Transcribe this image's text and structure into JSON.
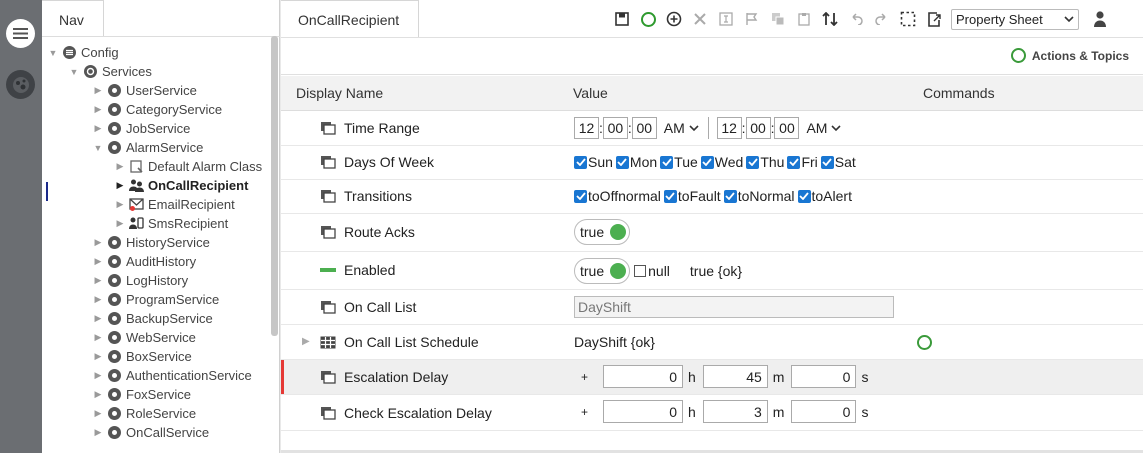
{
  "nav": {
    "tab": "Nav",
    "tree": [
      {
        "label": "Config",
        "depth": 0,
        "icon": "config-icon",
        "expand": "open"
      },
      {
        "label": "Services",
        "depth": 1,
        "icon": "services-icon",
        "expand": "open"
      },
      {
        "label": "UserService",
        "depth": 2,
        "icon": "user-service-icon",
        "expand": "closed"
      },
      {
        "label": "CategoryService",
        "depth": 2,
        "icon": "category-service-icon",
        "expand": "closed"
      },
      {
        "label": "JobService",
        "depth": 2,
        "icon": "job-service-icon",
        "expand": "closed"
      },
      {
        "label": "AlarmService",
        "depth": 2,
        "icon": "alarm-service-icon",
        "expand": "open"
      },
      {
        "label": "Default Alarm Class",
        "depth": 3,
        "icon": "alarm-class-icon",
        "expand": "closed"
      },
      {
        "label": "OnCallRecipient",
        "depth": 3,
        "icon": "on-call-recipient-icon",
        "expand": "closed",
        "selected": true
      },
      {
        "label": "EmailRecipient",
        "depth": 3,
        "icon": "email-recipient-icon",
        "expand": "closed"
      },
      {
        "label": "SmsRecipient",
        "depth": 3,
        "icon": "sms-recipient-icon",
        "expand": "closed"
      },
      {
        "label": "HistoryService",
        "depth": 2,
        "icon": "history-service-icon",
        "expand": "closed"
      },
      {
        "label": "AuditHistory",
        "depth": 2,
        "icon": "audit-history-icon",
        "expand": "closed"
      },
      {
        "label": "LogHistory",
        "depth": 2,
        "icon": "log-history-icon",
        "expand": "closed"
      },
      {
        "label": "ProgramService",
        "depth": 2,
        "icon": "program-service-icon",
        "expand": "closed"
      },
      {
        "label": "BackupService",
        "depth": 2,
        "icon": "backup-service-icon",
        "expand": "closed"
      },
      {
        "label": "WebService",
        "depth": 2,
        "icon": "web-service-icon",
        "expand": "closed"
      },
      {
        "label": "BoxService",
        "depth": 2,
        "icon": "box-service-icon",
        "expand": "closed"
      },
      {
        "label": "AuthenticationService",
        "depth": 2,
        "icon": "authentication-service-icon",
        "expand": "closed"
      },
      {
        "label": "FoxService",
        "depth": 2,
        "icon": "fox-service-icon",
        "expand": "closed"
      },
      {
        "label": "RoleService",
        "depth": 2,
        "icon": "role-service-icon",
        "expand": "closed"
      },
      {
        "label": "OnCallService",
        "depth": 2,
        "icon": "on-call-service-icon",
        "expand": "closed"
      }
    ]
  },
  "main": {
    "tab": "OnCallRecipient",
    "view_select": "Property Sheet",
    "actions_label": "Actions & Topics",
    "columns": {
      "name": "Display Name",
      "value": "Value",
      "commands": "Commands"
    },
    "time_range": {
      "label": "Time Range",
      "start": {
        "h": "12",
        "m": "00",
        "s": "00",
        "ampm": "AM"
      },
      "end": {
        "h": "12",
        "m": "00",
        "s": "00",
        "ampm": "AM"
      }
    },
    "days_of_week": {
      "label": "Days Of Week",
      "items": [
        {
          "label": "Sun",
          "checked": true
        },
        {
          "label": "Mon",
          "checked": true
        },
        {
          "label": "Tue",
          "checked": true
        },
        {
          "label": "Wed",
          "checked": true
        },
        {
          "label": "Thu",
          "checked": true
        },
        {
          "label": "Fri",
          "checked": true
        },
        {
          "label": "Sat",
          "checked": true
        }
      ]
    },
    "transitions": {
      "label": "Transitions",
      "items": [
        {
          "label": "toOffnormal",
          "checked": true
        },
        {
          "label": "toFault",
          "checked": true
        },
        {
          "label": "toNormal",
          "checked": true
        },
        {
          "label": "toAlert",
          "checked": true
        }
      ]
    },
    "route_acks": {
      "label": "Route Acks",
      "value": "true"
    },
    "enabled": {
      "label": "Enabled",
      "value": "true",
      "null_label": "null",
      "status": "true {ok}"
    },
    "on_call_list": {
      "label": "On Call List",
      "value": "DayShift"
    },
    "on_call_list_schedule": {
      "label": "On Call List Schedule",
      "value": "DayShift {ok}"
    },
    "escalation_delay": {
      "label": "Escalation Delay",
      "sign": "+",
      "h": "0",
      "m": "45",
      "s": "0",
      "h_unit": "h",
      "m_unit": "m",
      "s_unit": "s"
    },
    "check_escalation_delay": {
      "label": "Check Escalation Delay",
      "sign": "+",
      "h": "0",
      "m": "3",
      "s": "0",
      "h_unit": "h",
      "m_unit": "m",
      "s_unit": "s"
    }
  },
  "colors": {
    "accent": "#1976d2",
    "ok": "#4caf50",
    "selected_marker": "#e53935"
  }
}
